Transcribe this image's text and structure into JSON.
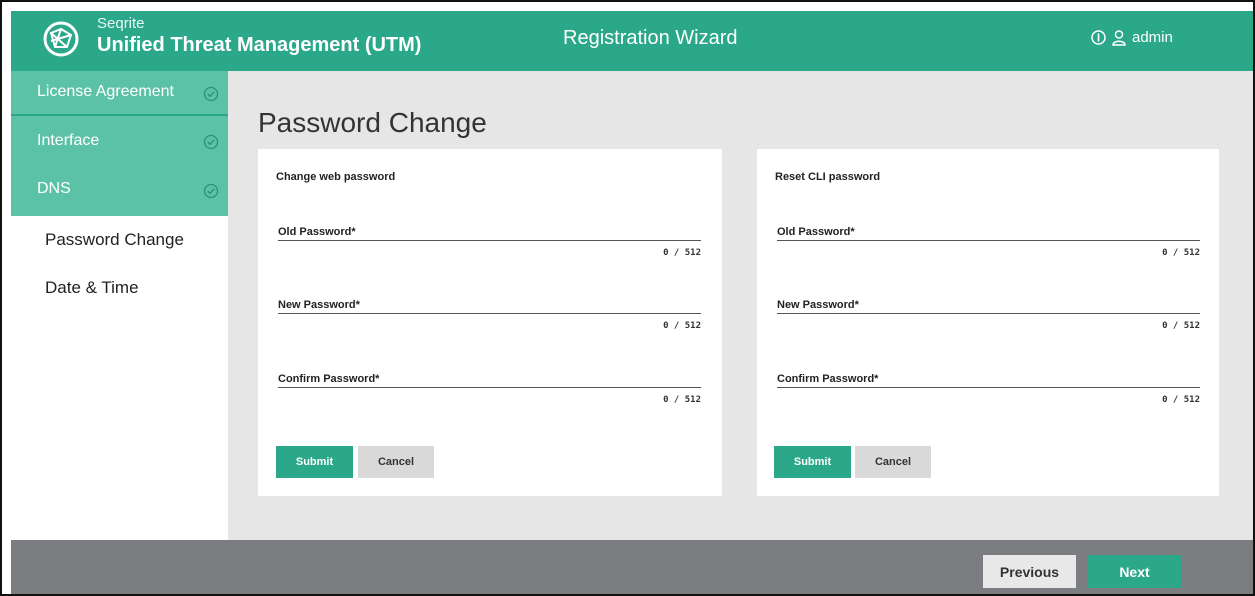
{
  "header": {
    "brand_small": "Seqrite",
    "brand_big": "Unified Threat Management (UTM)",
    "wizard_title": "Registration Wizard",
    "user_name": "admin",
    "logo_icon": "seqrite-logo-icon",
    "info_icon": "info-icon",
    "user_icon": "user-icon"
  },
  "sidebar": {
    "items": [
      {
        "label": "License Agreement",
        "state": "done"
      },
      {
        "label": "Interface",
        "state": "done"
      },
      {
        "label": "DNS",
        "state": "done"
      },
      {
        "label": "Password Change",
        "state": "active"
      },
      {
        "label": "Date & Time",
        "state": "pending"
      }
    ]
  },
  "main": {
    "page_title": "Password Change",
    "cards": [
      {
        "title": "Change web password",
        "fields": [
          {
            "label": "Old Password*",
            "counter": "0 / 512"
          },
          {
            "label": "New Password*",
            "counter": "0 / 512"
          },
          {
            "label": "Confirm Password*",
            "counter": "0 / 512"
          }
        ],
        "submit_label": "Submit",
        "cancel_label": "Cancel"
      },
      {
        "title": "Reset CLI password",
        "fields": [
          {
            "label": "Old Password*",
            "counter": "0 / 512"
          },
          {
            "label": "New Password*",
            "counter": "0 / 512"
          },
          {
            "label": "Confirm Password*",
            "counter": "0 / 512"
          }
        ],
        "submit_label": "Submit",
        "cancel_label": "Cancel"
      }
    ]
  },
  "footer": {
    "previous_label": "Previous",
    "next_label": "Next"
  },
  "colors": {
    "accent": "#2aa889",
    "sidebar_done": "#5cc2a6",
    "main_bg": "#e6e6e6",
    "footer_bg": "#7b7d80"
  }
}
